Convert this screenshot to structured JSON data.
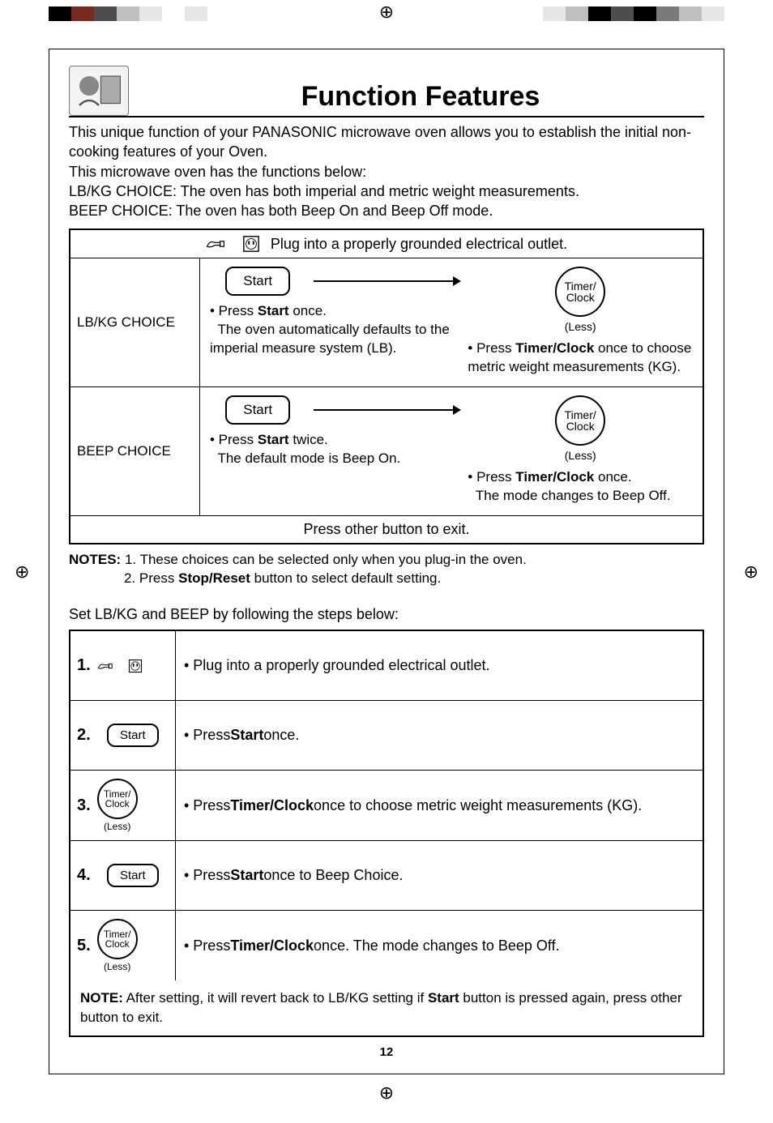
{
  "page_number": "12",
  "title": "Function Features",
  "intro": {
    "p1": "This unique function of your PANASONIC microwave oven allows you to establish the initial non-cooking features of your Oven.",
    "p2": "This microwave oven has the functions below:",
    "p3": "LB/KG CHOICE: The oven has both imperial and metric weight measurements.",
    "p4": "BEEP CHOICE: The oven has both Beep On and Beep Off mode."
  },
  "feature_box": {
    "head": "Plug into a properly grounded electrical outlet.",
    "rows": [
      {
        "label": "LB/KG CHOICE",
        "left_btn": "Start",
        "left_text_prefix": "• Press ",
        "left_text_bold": "Start",
        "left_text_suffix": " once.\nThe oven automatically defaults to the imperial measure system (LB).",
        "right_btn_line1": "Timer/",
        "right_btn_line2": "Clock",
        "right_less": "(Less)",
        "right_text_prefix": "• Press ",
        "right_text_bold": "Timer/Clock",
        "right_text_suffix": " once to choose metric weight measurements (KG)."
      },
      {
        "label": "BEEP CHOICE",
        "left_btn": "Start",
        "left_text_prefix": "• Press ",
        "left_text_bold": "Start",
        "left_text_suffix": " twice.\nThe default mode is Beep On.",
        "right_btn_line1": "Timer/",
        "right_btn_line2": "Clock",
        "right_less": "(Less)",
        "right_text_prefix": "• Press ",
        "right_text_bold": "Timer/Clock",
        "right_text_suffix": " once.\nThe mode changes to Beep Off."
      }
    ],
    "foot": "Press other button to exit."
  },
  "notes": {
    "label": "NOTES:",
    "n1": "1. These choices can be selected only when you plug-in the oven.",
    "n2_prefix": "2. Press ",
    "n2_bold": "Stop/Reset",
    "n2_suffix": " button to select default setting."
  },
  "subhead": "Set LB/KG and BEEP by following the steps below:",
  "steps": [
    {
      "num": "1.",
      "icon": "plug",
      "text_prefix": "• ",
      "text_bold": "",
      "text_plain": "Plug into a properly grounded electrical outlet."
    },
    {
      "num": "2.",
      "icon": "start",
      "btn": "Start",
      "text_prefix": "• Press ",
      "text_bold": "Start",
      "text_suffix": " once."
    },
    {
      "num": "3.",
      "icon": "timer",
      "btn_l1": "Timer/",
      "btn_l2": "Clock",
      "less": "(Less)",
      "text_prefix": "• Press ",
      "text_bold": "Timer/Clock",
      "text_suffix": " once to choose metric weight measurements (KG)."
    },
    {
      "num": "4.",
      "icon": "start",
      "btn": "Start",
      "text_prefix": "• Press ",
      "text_bold": "Start",
      "text_suffix": " once to Beep Choice."
    },
    {
      "num": "5.",
      "icon": "timer",
      "btn_l1": "Timer/",
      "btn_l2": "Clock",
      "less": "(Less)",
      "text_prefix": "• Press ",
      "text_bold": "Timer/Clock",
      "text_suffix": " once. The mode changes to Beep Off."
    }
  ],
  "step_note": {
    "label": "NOTE:",
    "text_prefix": " After setting, it will revert back to LB/KG setting if ",
    "text_bold": "Start",
    "text_suffix": " button is pressed again, press other button to exit."
  },
  "colors": {
    "strip1": [
      "#000",
      "#7a2a1e",
      "#4d4d4d",
      "#bfbfbf",
      "#e6e6e6",
      "#ffffff",
      "#e6e6e6"
    ],
    "strip2": [
      "#e6e6e6",
      "#bfbfbf",
      "#000",
      "#4d4d4d",
      "#000",
      "#7a7a7a",
      "#bfbfbf",
      "#e6e6e6"
    ]
  }
}
